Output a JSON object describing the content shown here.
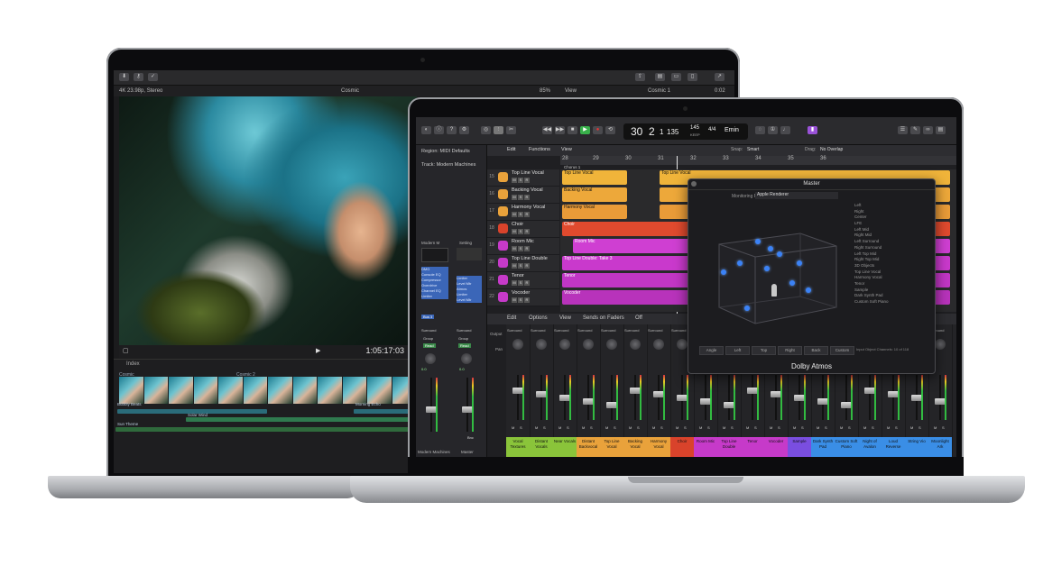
{
  "fcp": {
    "info_left": "4K 23.98p, Stereo",
    "title": "Cosmic",
    "zoom": "85%",
    "view": "View",
    "clip": "Cosmic 1",
    "clip_duration": "0:02",
    "timecode": "1:05:17:03",
    "index": "Index",
    "timeline_clips": [
      "Cosmic",
      "Cosmic 2"
    ],
    "audio_labels": [
      "Bubbly Beats",
      "Solar Wind",
      "Morning Echo",
      "Sun Theme"
    ]
  },
  "logic": {
    "lcd_bar": "30",
    "lcd_beat": "2",
    "lcd_div": "1",
    "lcd_tick": "135",
    "lcd_tempo": "145",
    "lcd_tempo_label": "KEEP",
    "lcd_sig": "4/4",
    "lcd_key": "Emin",
    "region_label": "Region: MIDI Defaults",
    "track_label": "Track: Modern Machines",
    "edit": "Edit",
    "functions": "Functions",
    "view": "View",
    "snap_label": "Snap:",
    "snap_value": "Smart",
    "drag_label": "Drag:",
    "drag_value": "No Overlap",
    "ruler": [
      "28",
      "29",
      "30",
      "31",
      "32",
      "33",
      "34",
      "35",
      "36"
    ],
    "marker": "Chorus 1",
    "tracks": [
      {
        "num": "15",
        "name": "Top Line Vocal",
        "color": "#e9a23b"
      },
      {
        "num": "16",
        "name": "Backing Vocal",
        "color": "#e9a23b"
      },
      {
        "num": "17",
        "name": "Harmony Vocal",
        "color": "#e9a23b"
      },
      {
        "num": "18",
        "name": "Choir",
        "color": "#d9432b"
      },
      {
        "num": "19",
        "name": "Room Mic",
        "color": "#c63ac9"
      },
      {
        "num": "20",
        "name": "Top Line Double",
        "color": "#c63ac9"
      },
      {
        "num": "21",
        "name": "Tenor",
        "color": "#c63ac9"
      },
      {
        "num": "22",
        "name": "Vocoder",
        "color": "#c63ac9"
      }
    ],
    "regions": [
      "Top Line Vocal",
      "Top Line Vocal",
      "Backing Vocal",
      "Harmony Vocal",
      "Choir",
      "Room Mic",
      "Top Line Double: Take 3",
      "Tenor",
      "Vocoder"
    ],
    "inspector": {
      "left_name": "Modern M",
      "right_name": "Setting",
      "plugins": [
        "DMG",
        "Console EQ",
        "Compressor",
        "Overdrive",
        "Channel EQ",
        "Limiter"
      ],
      "right_plugins": [
        "Limiter",
        "Level Mtr",
        "Atmos",
        "Limiter",
        "Level Mtr"
      ],
      "bus": "Bus 3",
      "surround": "Surround",
      "group": "Group",
      "read": "Read",
      "pan_values": [
        "0.0",
        "0.0"
      ],
      "strip_labels": [
        "Modern Machines",
        "Master"
      ],
      "bnc": "Bnc"
    },
    "mixer_bar": {
      "edit": "Edit",
      "options": "Options",
      "view": "View",
      "sends": "Sends on Faders",
      "off": "Off"
    },
    "mixer_row_labels": [
      "Output",
      "Pan"
    ],
    "mixer_output": "Surround",
    "strips": [
      {
        "name": "Vocal Textures",
        "color": "#8ac43a"
      },
      {
        "name": "Distant Vocals",
        "color": "#8ac43a"
      },
      {
        "name": "Near Vocals",
        "color": "#8ac43a"
      },
      {
        "name": "Distant Backvocal",
        "color": "#e9a23b"
      },
      {
        "name": "Top Line Vocal",
        "color": "#e9a23b"
      },
      {
        "name": "Backing Vocal",
        "color": "#e9a23b"
      },
      {
        "name": "Harmony Vocal",
        "color": "#e9a23b"
      },
      {
        "name": "Choir",
        "color": "#d9432b"
      },
      {
        "name": "Room Mic",
        "color": "#c63ac9"
      },
      {
        "name": "Top Line Double",
        "color": "#c63ac9"
      },
      {
        "name": "Tenor",
        "color": "#c63ac9"
      },
      {
        "name": "Vocoder",
        "color": "#c63ac9"
      },
      {
        "name": "Sample",
        "color": "#7a4ee0"
      },
      {
        "name": "Dark Synth Pad",
        "color": "#3a8ee6"
      },
      {
        "name": "Custom Soft Piano",
        "color": "#3a8ee6"
      },
      {
        "name": "Night of Avalon",
        "color": "#3a8ee6"
      },
      {
        "name": "Loud Reverse",
        "color": "#3a8ee6"
      },
      {
        "name": "String Vio",
        "color": "#3a8ee6"
      },
      {
        "name": "Moonlight Ark",
        "color": "#3a8ee6"
      }
    ],
    "atmos": {
      "title": "Master",
      "monitoring_label": "Monitoring Format:",
      "monitoring_value": "Apple Renderer",
      "footer": "Dolby Atmos",
      "channels": [
        "Left",
        "Right",
        "Center",
        "LFE",
        "Left Mid",
        "Right Mid",
        "Left Surround",
        "Right Surround",
        "Left Top Mid",
        "Right Top Mid",
        "3D Objects",
        "Top Line Vocal",
        "Harmony Vocal",
        "Tenor",
        "Sample",
        "Dark Synth Pad",
        "Custom Soft Piano"
      ],
      "tabs": [
        "Angle",
        "Left",
        "Top",
        "Right",
        "Back",
        "Custom"
      ],
      "status": "Input Object Channels: 10 of 118"
    }
  }
}
